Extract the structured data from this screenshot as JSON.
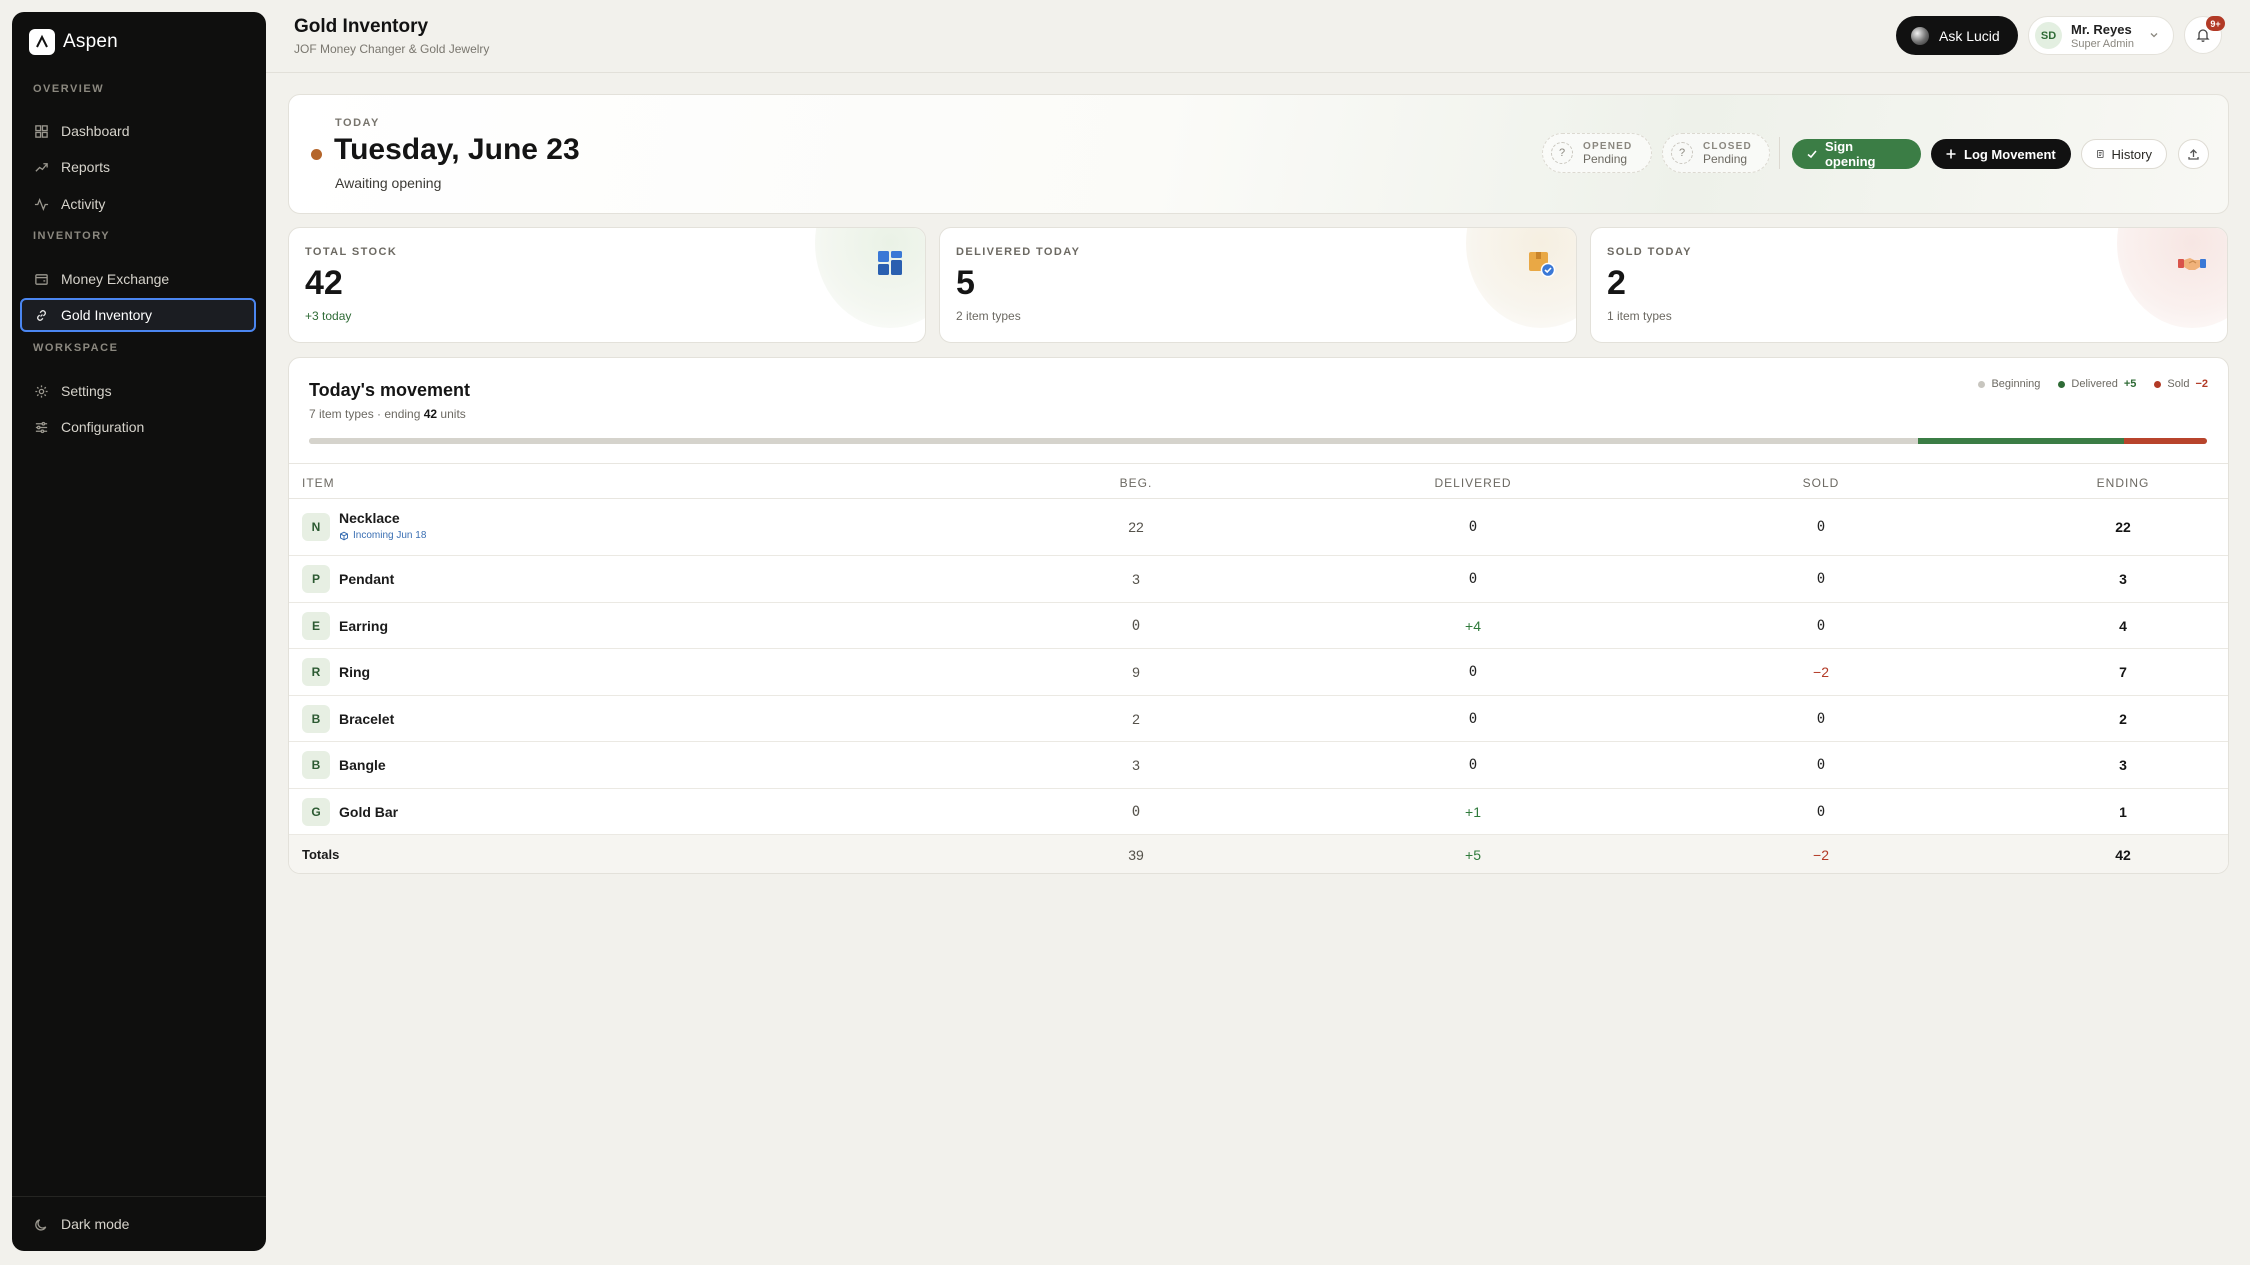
{
  "app": {
    "name": "Aspen"
  },
  "sidebar": {
    "sections": [
      {
        "title": "OVERVIEW",
        "items": [
          {
            "label": "Dashboard",
            "icon": "grid-icon"
          },
          {
            "label": "Reports",
            "icon": "trend-icon"
          },
          {
            "label": "Activity",
            "icon": "pulse-icon"
          }
        ]
      },
      {
        "title": "INVENTORY",
        "items": [
          {
            "label": "Money Exchange",
            "icon": "wallet-icon"
          },
          {
            "label": "Gold Inventory",
            "icon": "link-icon",
            "active": true
          }
        ]
      },
      {
        "title": "WORKSPACE",
        "items": [
          {
            "label": "Settings",
            "icon": "gear-icon"
          },
          {
            "label": "Configuration",
            "icon": "sliders-icon"
          }
        ]
      }
    ],
    "dark_mode_label": "Dark mode"
  },
  "header": {
    "title": "Gold Inventory",
    "subtitle": "JOF Money Changer & Gold Jewelry",
    "ask_label": "Ask Lucid",
    "user": {
      "initials": "SD",
      "name": "Mr. Reyes",
      "role": "Super Admin"
    },
    "notifications_badge": "9+"
  },
  "today": {
    "label": "TODAY",
    "date": "Tuesday, June 23",
    "status": "Awaiting opening",
    "opened": {
      "label": "OPENED",
      "value": "Pending",
      "mark": "?"
    },
    "closed": {
      "label": "CLOSED",
      "value": "Pending",
      "mark": "?"
    },
    "sign_opening_label": "Sign opening",
    "log_movement_label": "Log Movement",
    "history_label": "History"
  },
  "stats": [
    {
      "label": "TOTAL STOCK",
      "value": "42",
      "sub": "+3 today",
      "icon": "blocks-icon"
    },
    {
      "label": "DELIVERED TODAY",
      "value": "5",
      "sub": "2 item types",
      "icon": "package-check-icon"
    },
    {
      "label": "SOLD TODAY",
      "value": "2",
      "sub": "1 item types",
      "icon": "handshake-icon"
    }
  ],
  "movement": {
    "title": "Today's movement",
    "sub_prefix": "7 item types · ending ",
    "sub_count": "42",
    "sub_suffix": " units",
    "legend": {
      "beginning": "Beginning",
      "delivered": "Delivered",
      "delivered_value": "+5",
      "sold": "Sold",
      "sold_value": "−2"
    },
    "bar": {
      "beginning": 39,
      "delivered": 5,
      "sold": 2
    },
    "columns": [
      "ITEM",
      "BEG.",
      "DELIVERED",
      "SOLD",
      "ENDING"
    ],
    "rows": [
      {
        "letter": "N",
        "name": "Necklace",
        "note": "Incoming Jun 18",
        "beg": "22",
        "delivered": "0",
        "sold": "0",
        "ending": "22"
      },
      {
        "letter": "P",
        "name": "Pendant",
        "beg": "3",
        "delivered": "0",
        "sold": "0",
        "ending": "3"
      },
      {
        "letter": "E",
        "name": "Earring",
        "beg": "0",
        "delivered": "+4",
        "sold": "0",
        "ending": "4"
      },
      {
        "letter": "R",
        "name": "Ring",
        "beg": "9",
        "delivered": "0",
        "sold": "−2",
        "ending": "7"
      },
      {
        "letter": "B",
        "name": "Bracelet",
        "beg": "2",
        "delivered": "0",
        "sold": "0",
        "ending": "2"
      },
      {
        "letter": "B",
        "name": "Bangle",
        "beg": "3",
        "delivered": "0",
        "sold": "0",
        "ending": "3"
      },
      {
        "letter": "G",
        "name": "Gold Bar",
        "beg": "0",
        "delivered": "+1",
        "sold": "0",
        "ending": "1"
      }
    ],
    "totals": {
      "label": "Totals",
      "beg": "39",
      "delivered": "+5",
      "sold": "−2",
      "ending": "42"
    }
  },
  "colors": {
    "accent_green": "#3b7d45",
    "danger": "#b23a26",
    "focus": "#4b86f0",
    "sidebar_bg": "#0f0f0e"
  }
}
